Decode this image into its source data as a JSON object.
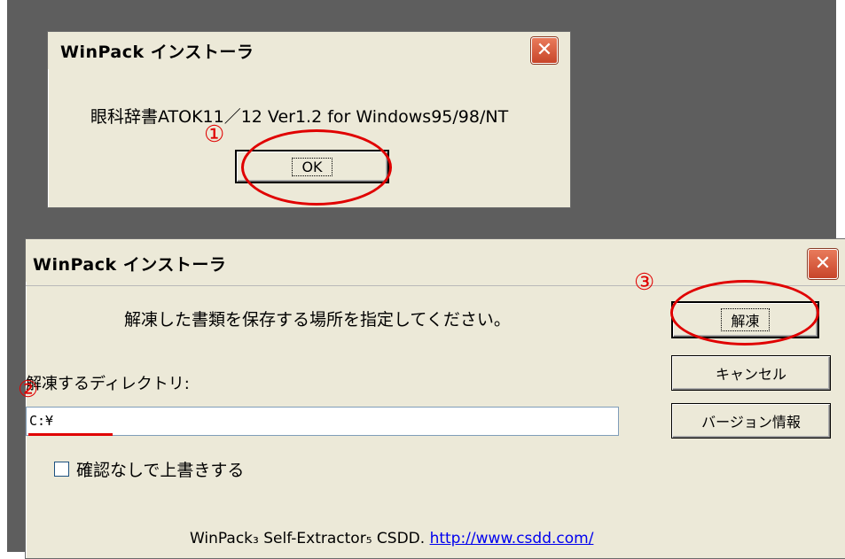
{
  "dialog1": {
    "title": "WinPack インストーラ",
    "message": "眼科辞書ATOK11／12 Ver1.2 for Windows95/98/NT",
    "ok_label": "OK",
    "close_label": "✕"
  },
  "dialog2": {
    "title": "WinPack インストーラ",
    "close_label": "✕",
    "instruction": "解凍した書類を保存する場所を指定してください。",
    "extract_label": "解凍",
    "cancel_label": "キャンセル",
    "version_label": "バージョン情報",
    "directory_label": "解凍するディレクトリ:",
    "directory_value": "C:¥",
    "overwrite_label": "確認なしで上書きする",
    "footer_text": "WinPack₃ Self-Extractor₅ CSDD.",
    "footer_link": "http://www.csdd.com/"
  },
  "annotations": {
    "marker_1": "①",
    "marker_2": "②",
    "marker_3": "③",
    "color": "#e00000"
  }
}
